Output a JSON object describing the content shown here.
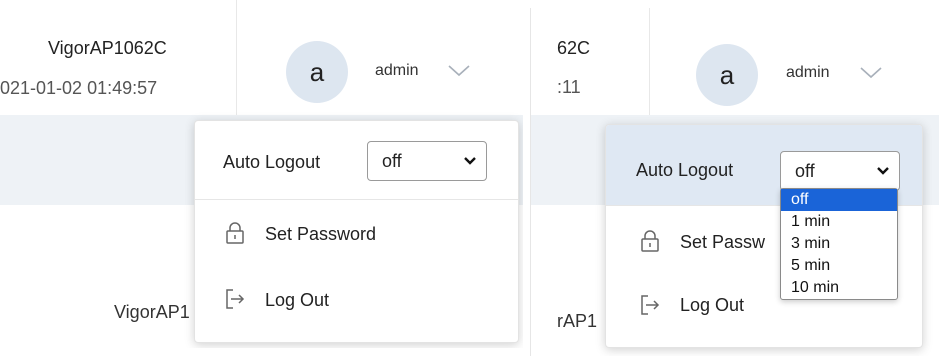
{
  "left": {
    "device_name": "VigorAP1062C",
    "device_time": "021-01-02 01:49:57",
    "avatar_letter": "a",
    "username": "admin",
    "bottom_text": "VigorAP1",
    "menu": {
      "auto_logout_label": "Auto Logout",
      "auto_logout_value": "off",
      "set_password_label": "Set Password",
      "log_out_label": "Log Out"
    }
  },
  "right": {
    "device_name": "62C",
    "device_time": ":11",
    "avatar_letter": "a",
    "username": "admin",
    "bottom_text": "rAP1",
    "menu": {
      "auto_logout_label": "Auto Logout",
      "auto_logout_value": "off",
      "set_password_label": "Set Passw",
      "log_out_label": "Log Out"
    },
    "dropdown_options": [
      "off",
      "1 min",
      "3 min",
      "5 min",
      "10 min"
    ],
    "selected_option": "off"
  },
  "colors": {
    "avatar_bg": "#dde6f0",
    "band_bg": "#eef2f6",
    "selected_bg": "#1a64d8"
  },
  "icons": {
    "chevron": "chevron-down-icon",
    "lock": "lock-icon",
    "logout": "logout-icon",
    "caret": "select-caret-icon"
  }
}
